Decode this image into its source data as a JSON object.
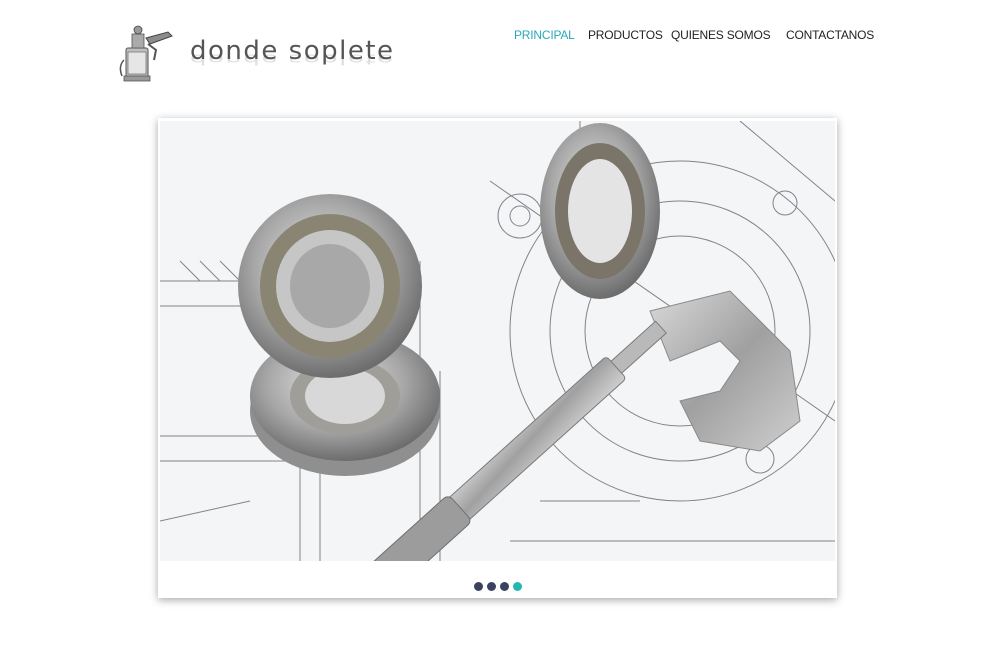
{
  "brand": {
    "name": "donde soplete"
  },
  "nav": {
    "items": [
      {
        "label": "PRINCIPAL",
        "active": true
      },
      {
        "label": "PRODUCTOS",
        "active": false
      },
      {
        "label": "QUIENES SOMOS",
        "active": false
      },
      {
        "label": "CONTACTANOS",
        "active": false
      }
    ]
  },
  "slider": {
    "dot_count": 4,
    "active_dot": 4
  },
  "colors": {
    "accent": "#2aa8b8",
    "dot": "#3a4260",
    "dot_active": "#23b7b3"
  }
}
